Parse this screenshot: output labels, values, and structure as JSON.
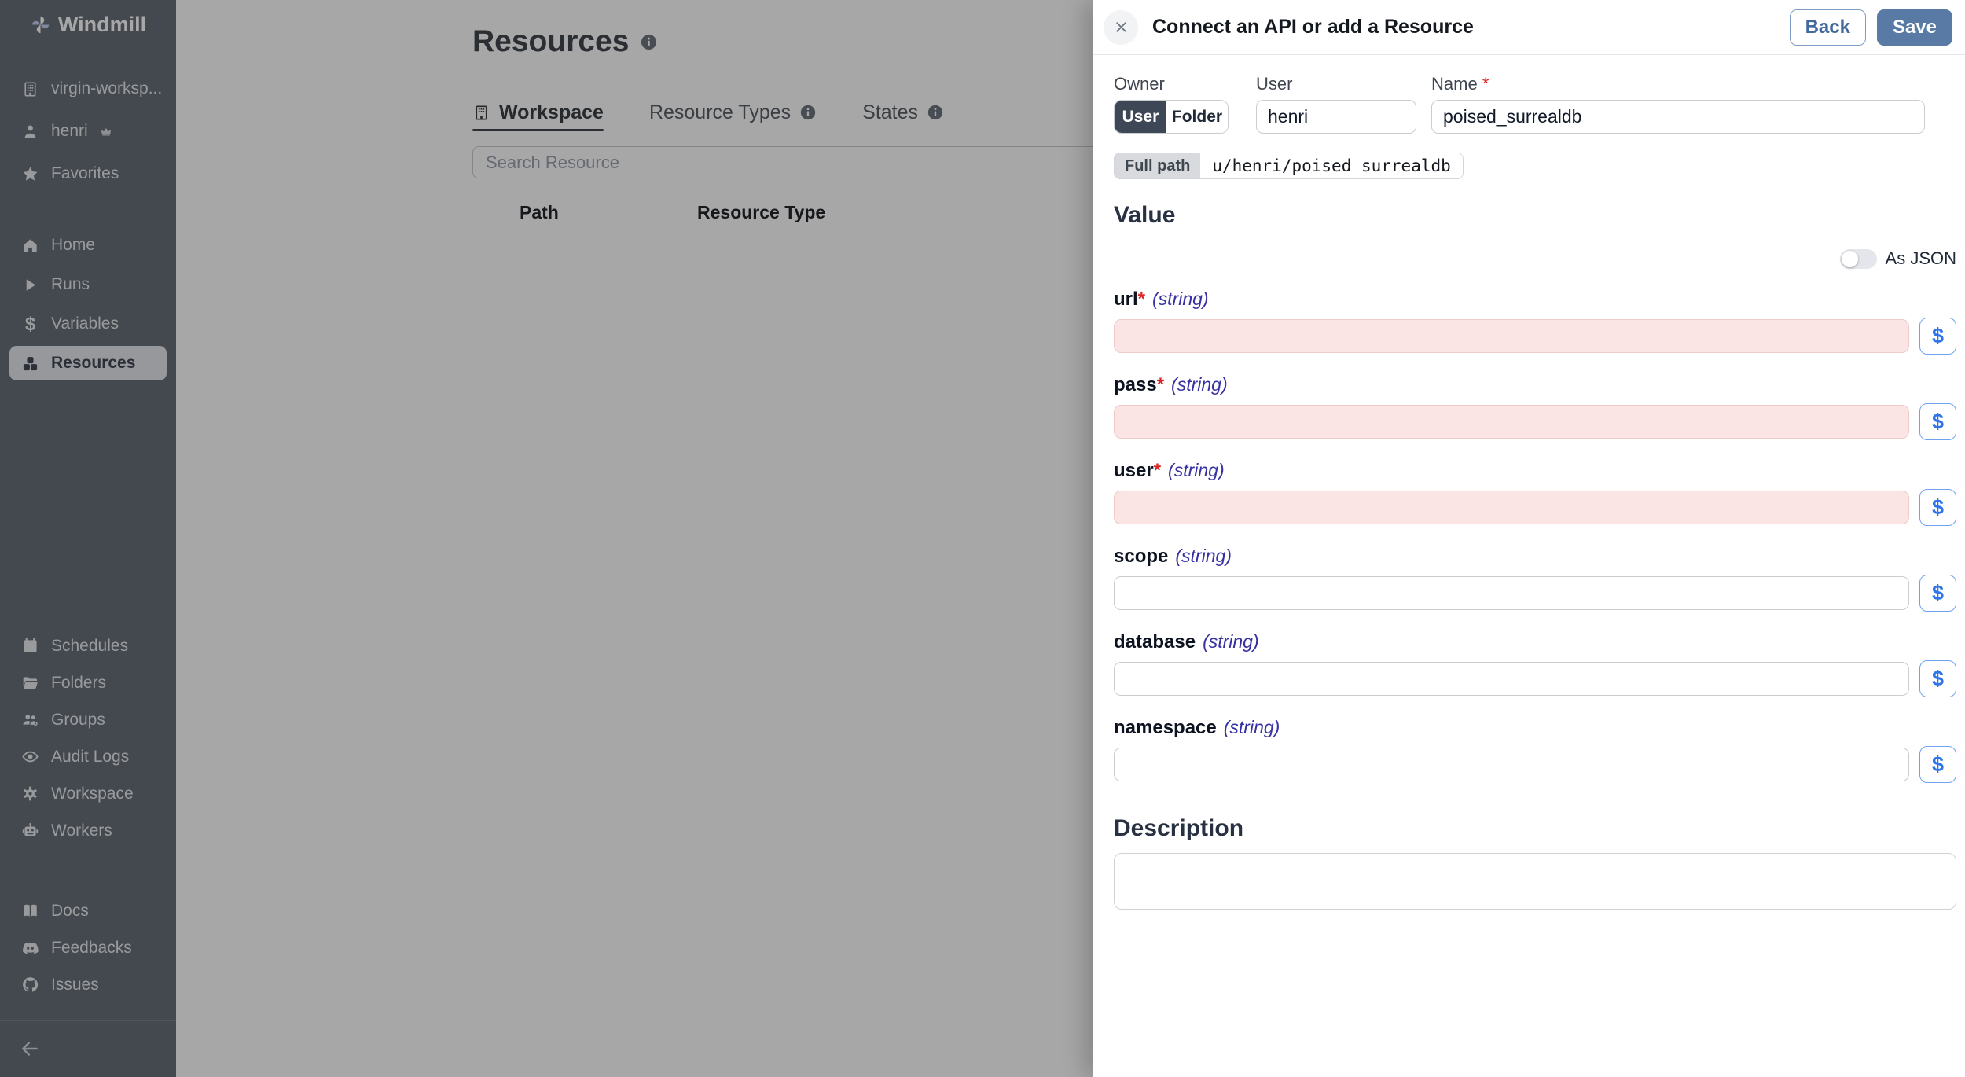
{
  "sidebar": {
    "app_name": "Windmill",
    "workspace": {
      "label": "virgin-worksp..."
    },
    "user": {
      "label": "henri"
    },
    "favorites": {
      "label": "Favorites"
    },
    "variables_glyph": "$",
    "nav": [
      {
        "label": "Home"
      },
      {
        "label": "Runs"
      },
      {
        "label": "Variables"
      },
      {
        "label": "Resources",
        "active": true
      }
    ],
    "manage": [
      {
        "label": "Schedules"
      },
      {
        "label": "Folders"
      },
      {
        "label": "Groups"
      },
      {
        "label": "Audit Logs"
      },
      {
        "label": "Workspace"
      },
      {
        "label": "Workers"
      }
    ],
    "links": [
      {
        "label": "Docs"
      },
      {
        "label": "Feedbacks"
      },
      {
        "label": "Issues"
      }
    ]
  },
  "main": {
    "title": "Resources",
    "tabs": [
      {
        "label": "Workspace",
        "active": true
      },
      {
        "label": "Resource Types"
      },
      {
        "label": "States"
      }
    ],
    "search_placeholder": "Search Resource",
    "columns": [
      {
        "label": "Path"
      },
      {
        "label": "Resource Type"
      }
    ]
  },
  "drawer": {
    "title": "Connect an API or add a Resource",
    "back_label": "Back",
    "save_label": "Save",
    "required_marker": "*",
    "owner": {
      "label": "Owner",
      "user_option": "User",
      "folder_option": "Folder",
      "selected": "User"
    },
    "user_field": {
      "label": "User",
      "value": "henri"
    },
    "name_field": {
      "label": "Name",
      "value": "poised_surrealdb",
      "required": true
    },
    "full_path": {
      "label": "Full path",
      "value": "u/henri/poised_surrealdb"
    },
    "value_section": {
      "heading": "Value",
      "as_json_label": "As JSON",
      "as_json_on": false
    },
    "dollar_button": "$",
    "fields": [
      {
        "name": "url",
        "type": "(string)",
        "required": true,
        "value": ""
      },
      {
        "name": "pass",
        "type": "(string)",
        "required": true,
        "value": ""
      },
      {
        "name": "user",
        "type": "(string)",
        "required": true,
        "value": ""
      },
      {
        "name": "scope",
        "type": "(string)",
        "required": false,
        "value": ""
      },
      {
        "name": "database",
        "type": "(string)",
        "required": false,
        "value": ""
      },
      {
        "name": "namespace",
        "type": "(string)",
        "required": false,
        "value": ""
      }
    ],
    "description": {
      "heading": "Description",
      "value": ""
    }
  },
  "colors": {
    "accent_blue": "#587aa5",
    "required_field_bg": "#fbe4e4",
    "dollar_blue": "#2f74e8",
    "sidebar_bg": "#686e79"
  }
}
